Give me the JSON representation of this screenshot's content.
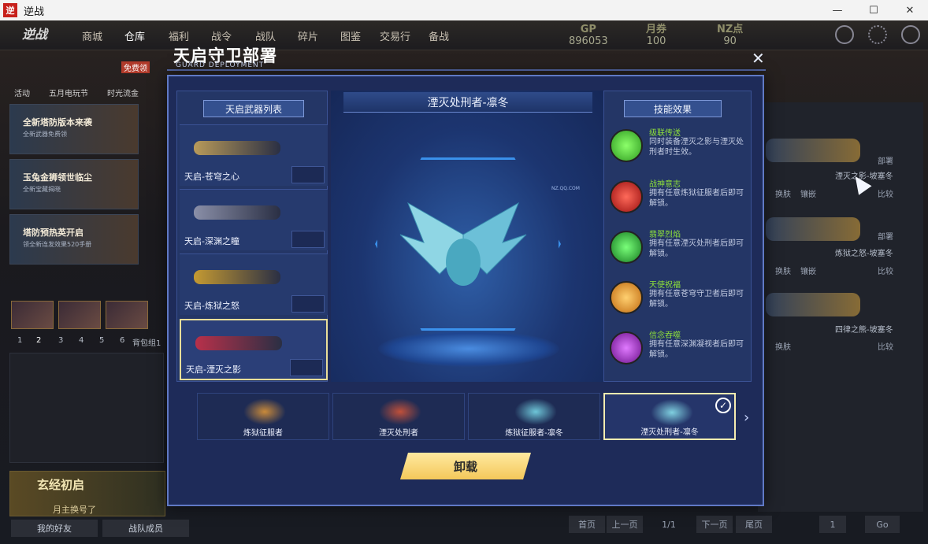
{
  "window": {
    "title": "逆战",
    "icon_text": "逆",
    "minimize": "—",
    "maximize": "☐",
    "close": "✕"
  },
  "nav": {
    "logo": "逆战",
    "tabs": [
      "商城",
      "仓库",
      "福利",
      "战令",
      "战队",
      "碎片",
      "图鉴",
      "交易行",
      "备战"
    ],
    "active_tab": "仓库"
  },
  "currency": [
    {
      "label": "GP",
      "value": "896053"
    },
    {
      "label": "月券",
      "value": "100"
    },
    {
      "label": "NZ点",
      "value": "90"
    }
  ],
  "shortcuts": [
    "活动",
    "五月电玩节",
    "时光流金"
  ],
  "shortcut_badge": "免费领",
  "promos": [
    {
      "title": "全新塔防版本来袭",
      "sub": "全新武器免费领"
    },
    {
      "title": "玉兔金狮领世临尘",
      "sub": "全新宝藏揭晓"
    },
    {
      "title": "塔防预热英开启",
      "sub": "领全新连发效果520手册"
    }
  ],
  "page_numbers": [
    "1",
    "2",
    "3",
    "4",
    "5",
    "6"
  ],
  "page_extra": "背包组1",
  "banner": {
    "title": "玄经初启",
    "sub": "月主换号了"
  },
  "bottom_tabs": [
    "我的好友",
    "战队成员"
  ],
  "right_list": [
    {
      "name": "湮灭之影-坡塞冬",
      "action": "部署"
    },
    {
      "name": "炼狱之怒-坡塞冬",
      "action": "部署"
    },
    {
      "name": "四律之熊-坡塞冬",
      "action": ""
    }
  ],
  "right_buttons": [
    "换肤",
    "镶嵌",
    "比较"
  ],
  "pager": {
    "first": "首页",
    "prev": "上一页",
    "info": "1/1",
    "next": "下一页",
    "last": "尾页",
    "input": "1",
    "go": "Go"
  },
  "modal": {
    "title": "天启守卫部署",
    "subtitle": "GUARD DEPLOYMENT",
    "close": "✕",
    "weapon_list_header": "天启武器列表",
    "weapons": [
      {
        "name": "天启-苍穹之心",
        "color": "#b89a5a"
      },
      {
        "name": "天启-深渊之瞳",
        "color": "#8a8fa8"
      },
      {
        "name": "天启-炼狱之怒",
        "color": "#c59a32"
      },
      {
        "name": "天启-湮灭之影",
        "color": "#b8304a"
      }
    ],
    "selected_weapon": "天启-湮灭之影",
    "center_title": "湮灭处刑者-凛冬",
    "watermark": "NZ.QQ.COM",
    "skill_header": "技能效果",
    "skills": [
      {
        "name": "级联传送",
        "desc": "同时装备湮灭之影与湮灭处刑者时生效。",
        "color": "#46c832",
        "icon": "wifi-icon"
      },
      {
        "name": "战神意志",
        "desc": "拥有任意炼狱征服者后即可解锁。",
        "color": "#d8282a",
        "icon": "fist-icon"
      },
      {
        "name": "翡翠烈焰",
        "desc": "拥有任意湮灭处刑者后即可解锁。",
        "color": "#2fa83a",
        "icon": "flame-icon"
      },
      {
        "name": "天使祝福",
        "desc": "拥有任意苍穹守卫者后即可解锁。",
        "color": "#f0a020",
        "icon": "heart-icon"
      },
      {
        "name": "信念吞噬",
        "desc": "拥有任意深渊凝视者后即可解锁。",
        "color": "#a030d0",
        "icon": "orb-icon"
      }
    ],
    "summons": [
      {
        "name": "炼狱征服者",
        "color": "#c98a3a"
      },
      {
        "name": "湮灭处刑者",
        "color": "#c0503a"
      },
      {
        "name": "炼狱征服者-凛冬",
        "color": "#6ec6d8"
      },
      {
        "name": "湮灭处刑者-凛冬",
        "color": "#7fd0e0"
      }
    ],
    "selected_summon": "湮灭处刑者-凛冬",
    "unload_label": "卸载",
    "next_arrow": "›",
    "check": "✓"
  }
}
